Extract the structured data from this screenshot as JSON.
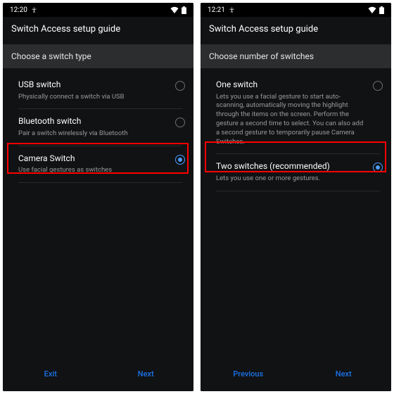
{
  "left": {
    "status": {
      "time": "12:20"
    },
    "header": "Switch Access setup guide",
    "subheader": "Choose a switch type",
    "options": [
      {
        "title": "USB switch",
        "desc": "Physically connect a switch via USB"
      },
      {
        "title": "Bluetooth switch",
        "desc": "Pair a switch wirelessly via Bluetooth"
      },
      {
        "title": "Camera Switch",
        "desc": "Use facial gestures as switches"
      }
    ],
    "buttons": {
      "left": "Exit",
      "right": "Next"
    }
  },
  "right": {
    "status": {
      "time": "12:21"
    },
    "header": "Switch Access setup guide",
    "subheader": "Choose number of switches",
    "options": [
      {
        "title": "One switch",
        "desc": "Lets you use a facial gesture to start auto-scanning, automatically moving the highlight through the items on the screen. Perform the gesture a second time to select. You can also add a second gesture to temporarily pause Camera Switches."
      },
      {
        "title": "Two switches (recommended)",
        "desc": "Lets you use one or more gestures."
      }
    ],
    "buttons": {
      "left": "Previous",
      "right": "Next"
    }
  }
}
